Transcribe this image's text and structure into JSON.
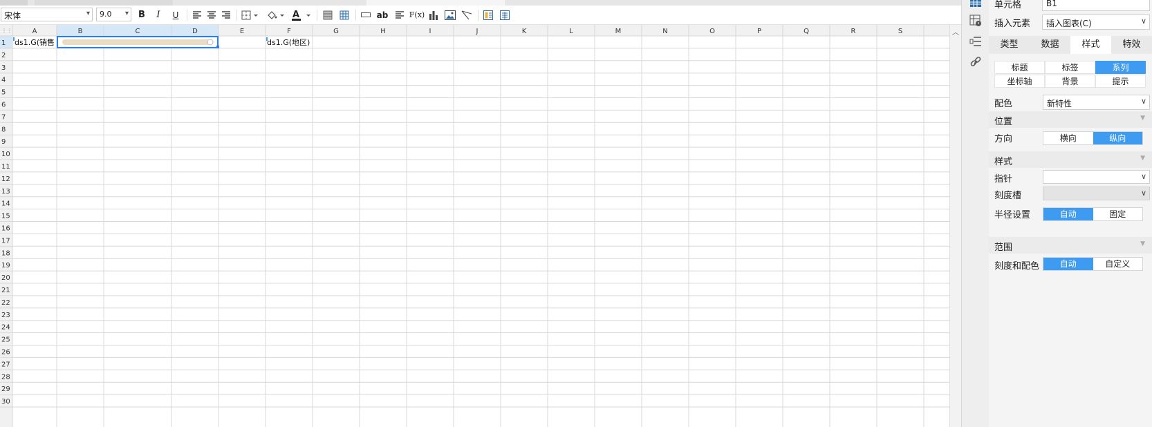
{
  "toolbar": {
    "font_name": "宋体",
    "font_size": "9.0",
    "bold_label": "B",
    "italic_label": "I",
    "underline_label": "U",
    "wrap_label": "ab",
    "formula_label": "F(x)"
  },
  "sheet": {
    "columns": [
      "A",
      "B",
      "C",
      "D",
      "E",
      "F",
      "G",
      "H",
      "I",
      "J",
      "K",
      "L",
      "M",
      "N",
      "O",
      "P",
      "Q",
      "R",
      "S"
    ],
    "rows": [
      "1",
      "2",
      "3",
      "4",
      "5",
      "6",
      "7",
      "8",
      "9",
      "10",
      "11",
      "12",
      "13",
      "14",
      "15",
      "16",
      "17",
      "18",
      "19",
      "20",
      "21",
      "22",
      "23",
      "24",
      "25",
      "26",
      "27",
      "28",
      "29",
      "30"
    ],
    "cell_a1": "ds1.G(销售",
    "cell_f1": "ds1.G(地区)"
  },
  "panel": {
    "cell_label": "单元格",
    "cell_value": "B1",
    "insert_label": "插入元素",
    "insert_value": "插入图表(C)",
    "tabs": [
      "类型",
      "数据",
      "样式",
      "特效"
    ],
    "active_tab": "样式",
    "subtabs_row1": [
      "标题",
      "标签",
      "系列"
    ],
    "subtabs_row2": [
      "坐标轴",
      "背景",
      "提示"
    ],
    "active_subtab": "系列",
    "color_label": "配色",
    "color_value": "新特性",
    "position_section": "位置",
    "direction_label": "方向",
    "direction_options": [
      "横向",
      "纵向"
    ],
    "direction_selected": "纵向",
    "style_section": "样式",
    "pointer_label": "指针",
    "pointer_value": "",
    "scale_label": "刻度槽",
    "scale_value": "",
    "radius_label": "半径设置",
    "radius_options": [
      "自动",
      "固定"
    ],
    "radius_selected": "自动",
    "range_section": "范围",
    "scale_color_label": "刻度和配色",
    "scale_color_options": [
      "自动",
      "自定义"
    ],
    "scale_color_selected": "自动"
  },
  "colors": {
    "accent": "#3d9bf2",
    "selection_header": "#d6e8f8",
    "gauge_track": "#e8dcc4"
  }
}
